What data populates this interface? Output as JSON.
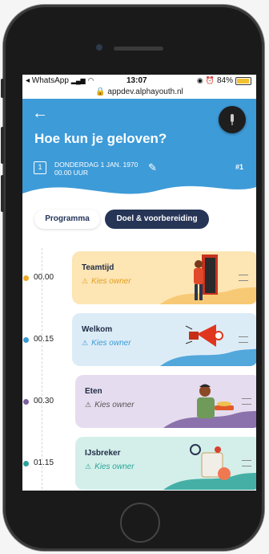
{
  "status_bar": {
    "back_app": "◂ WhatsApp",
    "time": "13:07",
    "battery": "84%",
    "battery_level": 0.84
  },
  "url": "🔒 appdev.alphayouth.nl",
  "header": {
    "back_icon": "←",
    "title": "Hoe kun je geloven?",
    "date_line1": "DONDERDAG 1 JAN. 1970",
    "date_line2": "00.00 UUR",
    "calendar_day": "1",
    "edit_icon": "✎",
    "number": "#1"
  },
  "tabs": [
    {
      "label": "Programma",
      "active": true
    },
    {
      "label": "Doel & voorbereiding",
      "active": false
    }
  ],
  "items": [
    {
      "time": "00.00",
      "title": "Teamtijd",
      "owner": "Kies owner",
      "dot": "#f0a928",
      "bg": "#fde5b4",
      "accent": "#f7c46a",
      "owner_color": "#e0a020"
    },
    {
      "time": "00.15",
      "title": "Welkom",
      "owner": "Kies owner",
      "dot": "#3a9bd6",
      "bg": "#dcecf7",
      "accent": "#3a9bd6",
      "owner_color": "#3a9bd6"
    },
    {
      "time": "00.30",
      "title": "Eten",
      "owner": "Kies owner",
      "dot": "#7b5fa0",
      "bg": "#e6dcef",
      "accent": "#7b5fa0",
      "owner_color": "#555"
    },
    {
      "time": "01.15",
      "title": "IJsbreker",
      "owner": "Kies owner",
      "dot": "#2ba39a",
      "bg": "#d4efea",
      "accent": "#2ba39a",
      "owner_color": "#2ba39a"
    }
  ],
  "warning_icon": "⚠"
}
